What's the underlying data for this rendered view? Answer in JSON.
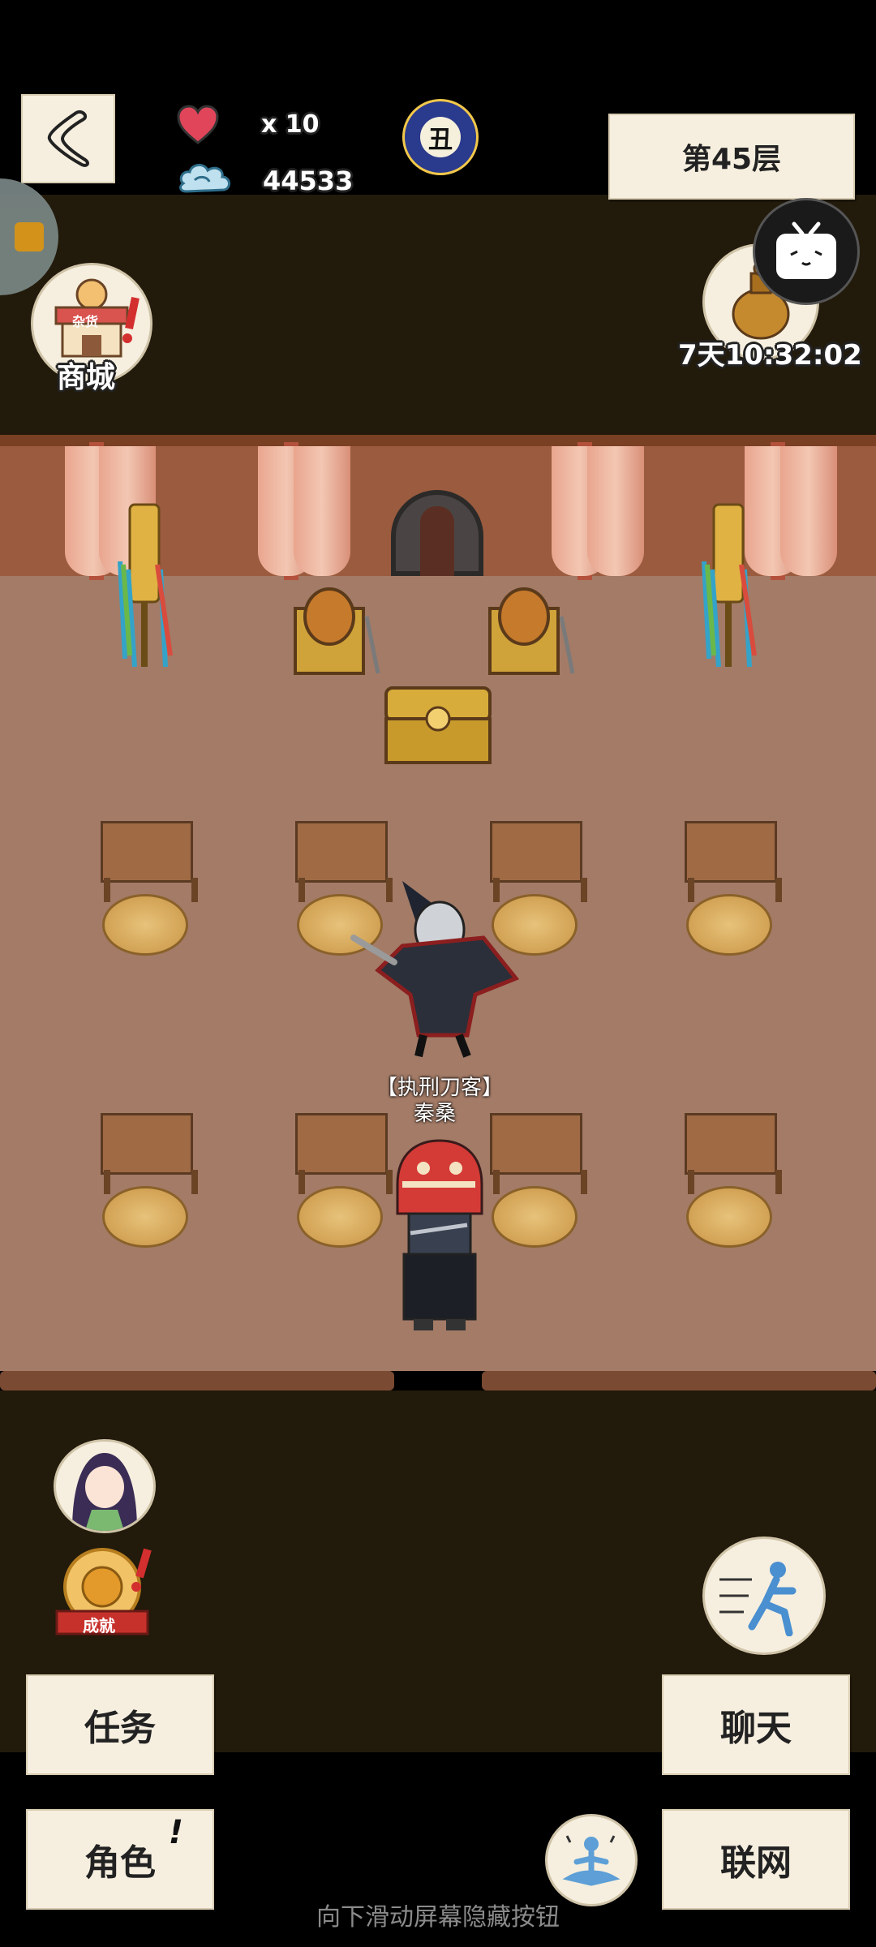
{
  "hud": {
    "lives": "x 10",
    "currency": "44533",
    "time_badge": "丑",
    "floor_label": "第45层",
    "timer": "7天10:32:02"
  },
  "shop": {
    "label": "商城",
    "sign": "杂货"
  },
  "npc": {
    "title": "【执刑刀客】",
    "name": "秦桑"
  },
  "achievement": {
    "label": "成就"
  },
  "buttons": {
    "task": "任务",
    "role": "角色",
    "role_mark": "!",
    "chat": "聊天",
    "online": "联网"
  },
  "hint": "向下滑动屏幕隐藏按钮",
  "colors": {
    "top_band": "#221a0b",
    "floor": "#a37b67",
    "wall": "#9a5b3f"
  }
}
